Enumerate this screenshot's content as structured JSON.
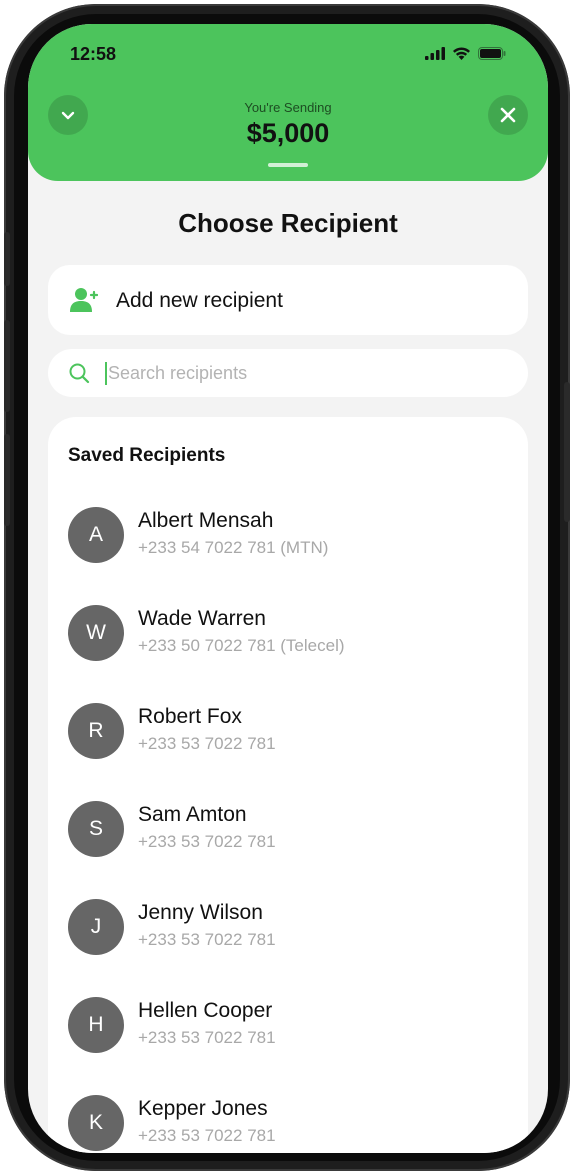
{
  "status_bar": {
    "time": "12:58"
  },
  "header": {
    "sending_label": "You're Sending",
    "amount": "$5,000",
    "collapse_icon": "chevron-down-icon",
    "close_icon": "close-icon",
    "accent_color": "#4cc45c"
  },
  "page": {
    "title": "Choose Recipient"
  },
  "add_recipient": {
    "label": "Add new recipient",
    "icon": "add-user-icon"
  },
  "search": {
    "placeholder": "Search recipients",
    "value": ""
  },
  "saved": {
    "title": "Saved Recipients",
    "recipients": [
      {
        "initial": "A",
        "name": "Albert Mensah",
        "phone": "+233 54 7022 781 (MTN)"
      },
      {
        "initial": "W",
        "name": "Wade Warren",
        "phone": "+233 50 7022 781 (Telecel)"
      },
      {
        "initial": "R",
        "name": "Robert Fox",
        "phone": "+233 53 7022 781"
      },
      {
        "initial": "S",
        "name": "Sam Amton",
        "phone": "+233 53 7022 781"
      },
      {
        "initial": "J",
        "name": "Jenny Wilson",
        "phone": "+233 53 7022 781"
      },
      {
        "initial": "H",
        "name": "Hellen Cooper",
        "phone": "+233 53 7022 781"
      },
      {
        "initial": "K",
        "name": "Kepper Jones",
        "phone": "+233 53 7022 781"
      }
    ]
  }
}
